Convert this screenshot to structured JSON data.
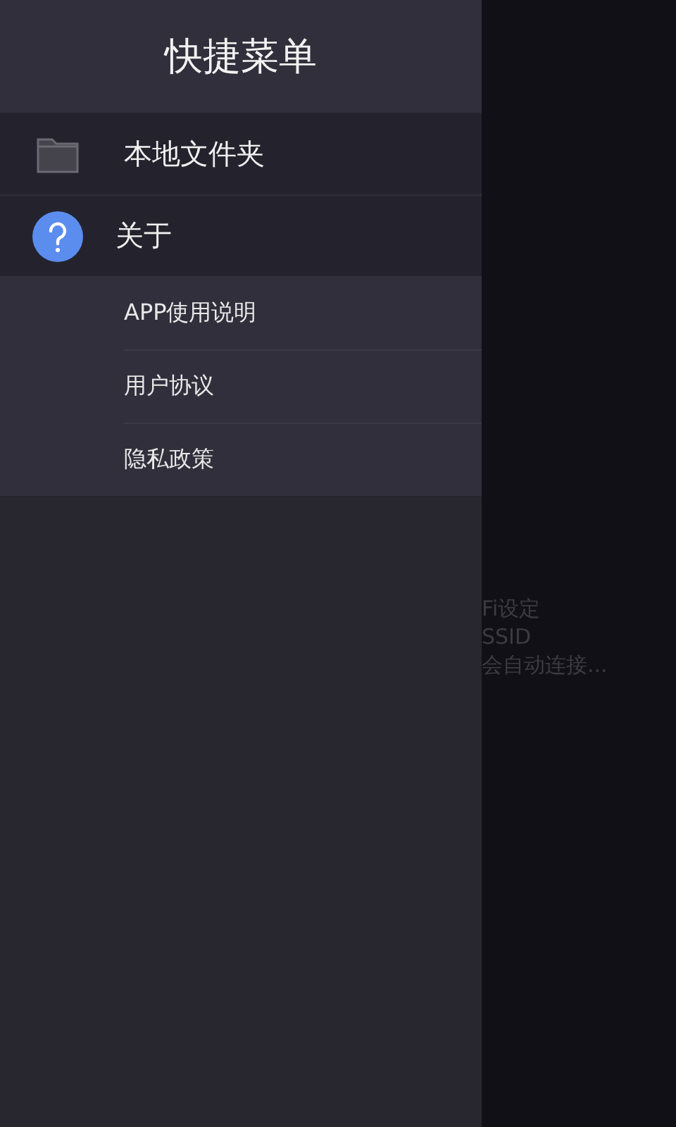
{
  "background_lines": [
    "Fi设定",
    "SSID",
    "会自动连接..."
  ],
  "drawer": {
    "title": "快捷菜单",
    "items": [
      {
        "label": "本地文件夹",
        "kind": "folder"
      },
      {
        "label": "关于",
        "kind": "help",
        "expanded": true,
        "children": [
          {
            "label": "APP使用说明"
          },
          {
            "label": "用户协议"
          },
          {
            "label": "隐私政策"
          }
        ]
      }
    ]
  }
}
